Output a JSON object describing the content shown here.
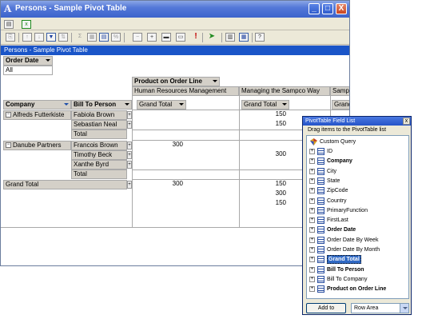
{
  "window": {
    "title": "Persons - Sample Pivot Table",
    "minimize_label": "_",
    "maximize_label": "□",
    "close_label": "X",
    "app_icon": "A"
  },
  "toolbar": {
    "icons": [
      "properties-icon",
      "export-excel-icon"
    ],
    "pivot_icons": [
      "copy-icon",
      "sort-ascending-icon",
      "sort-descending-icon",
      "autofilter-icon",
      "show-top-bottom-icon",
      "autocalc-icon",
      "subtotal-icon",
      "calculated-field-icon",
      "show-as-icon",
      "collapse-icon",
      "expand-icon",
      "hide-details-icon",
      "show-details-icon",
      "refresh-icon",
      "export-icon",
      "chart-icon",
      "field-list-icon",
      "properties-icon",
      "help-icon"
    ]
  },
  "pivot": {
    "title": "Persons - Sample Pivot Table",
    "filter_field": "Order Date",
    "filter_value": "All",
    "column_field": "Product on Order Line",
    "column_items": [
      "Human Resources Management",
      "Managing the Sampco Way",
      "Samp"
    ],
    "row_fields": [
      "Company",
      "Bill To Person"
    ],
    "grand_total_label": "Grand Total",
    "total_label": "Total",
    "rows": [
      {
        "company": "Alfreds Futterkiste",
        "persons": [
          "Fabiola Brown",
          "Sebastian Neal"
        ]
      },
      {
        "company": "Danube Partners",
        "persons": [
          "Francois Brown",
          "Timothy Beck",
          "Xanthe Byrd"
        ]
      }
    ],
    "values": {
      "fabiola_col2": "150",
      "sebastian_col2": "150",
      "francois_col1": "300",
      "timothy_col2": "300",
      "grand_col1": "300",
      "grand_col2_a": "150",
      "grand_col2_b": "300",
      "grand_col2_c": "150"
    }
  },
  "field_list": {
    "title": "PivotTable Field List",
    "close_label": "x",
    "hint": "Drag items to the PivotTable list",
    "root": "Custom Query",
    "fields": [
      {
        "label": "ID",
        "bold": false
      },
      {
        "label": "Company",
        "bold": true
      },
      {
        "label": "City",
        "bold": false
      },
      {
        "label": "State",
        "bold": false
      },
      {
        "label": "ZipCode",
        "bold": false
      },
      {
        "label": "Country",
        "bold": false
      },
      {
        "label": "PrimaryFunction",
        "bold": false
      },
      {
        "label": "FirstLast",
        "bold": false
      },
      {
        "label": "Order Date",
        "bold": true
      },
      {
        "label": "Order Date By Week",
        "bold": false
      },
      {
        "label": "Order Date By Month",
        "bold": false
      },
      {
        "label": "Grand Total",
        "bold": true,
        "selected": true
      },
      {
        "label": "Bill To Person",
        "bold": true
      },
      {
        "label": "Bill To Company",
        "bold": false
      },
      {
        "label": "Product on Order Line",
        "bold": true
      }
    ],
    "add_to_label": "Add to",
    "area_selected": "Row Area"
  }
}
